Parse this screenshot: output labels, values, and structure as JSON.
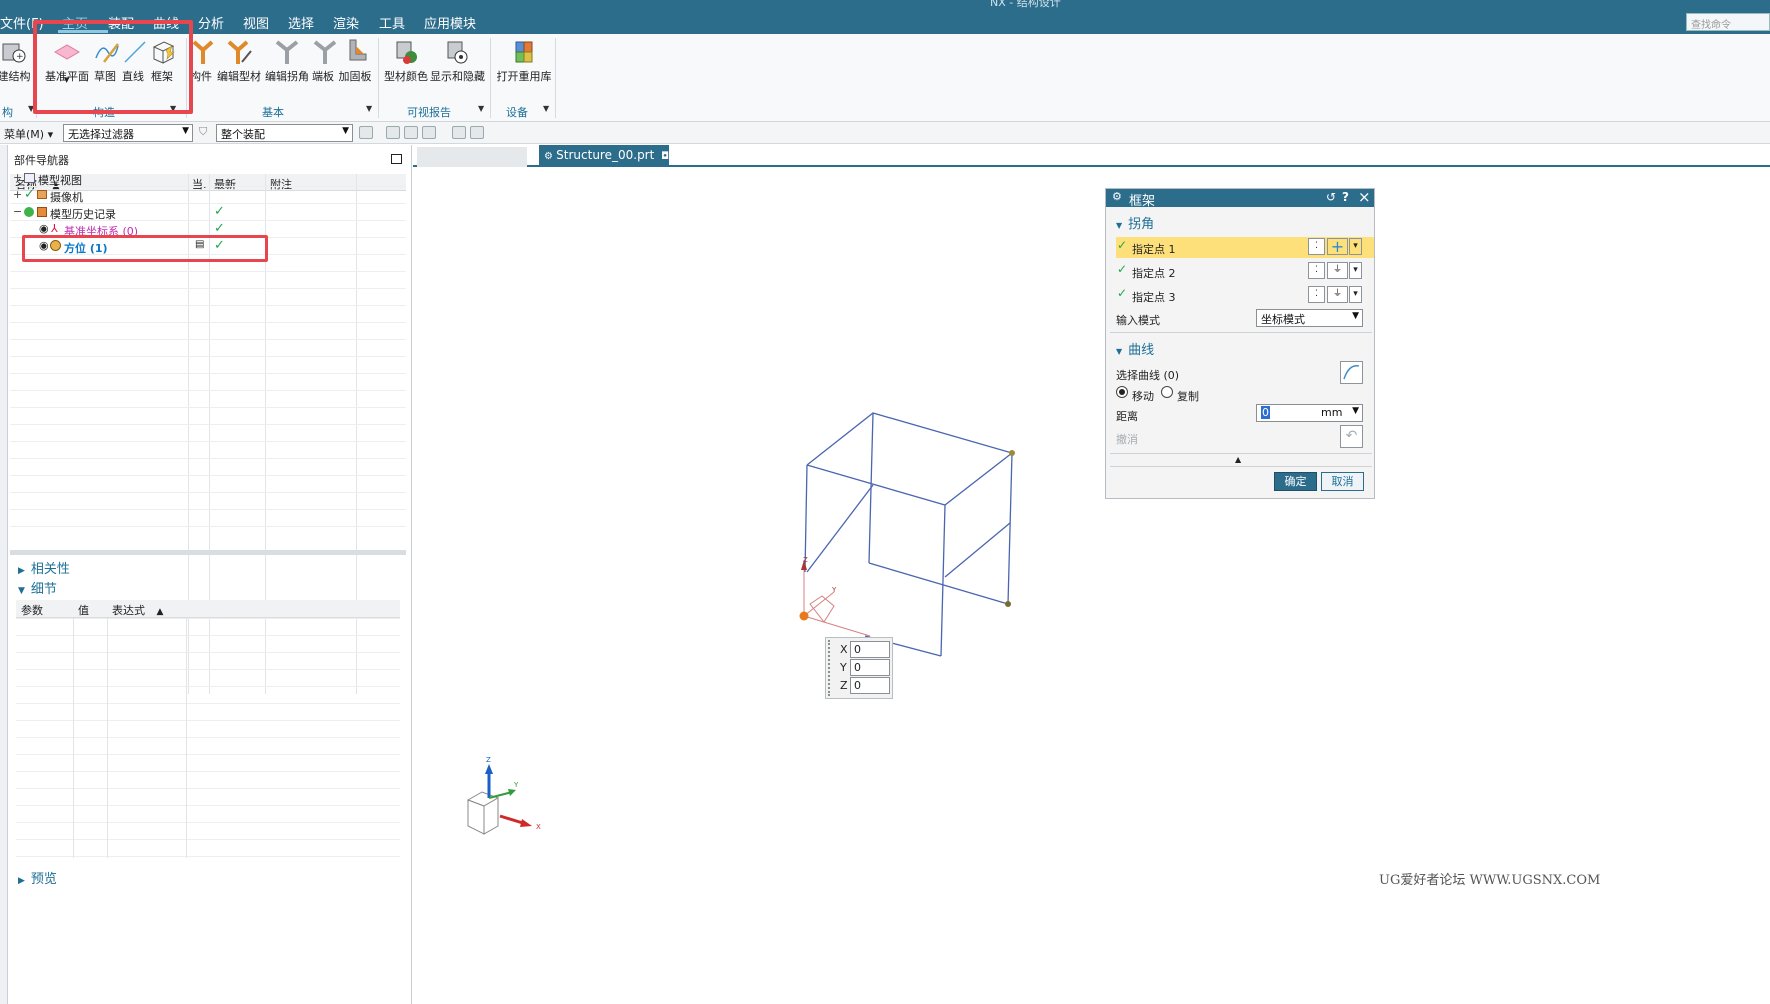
{
  "menu": {
    "items": [
      "文件(F)",
      "主页",
      "装配",
      "曲线",
      "分析",
      "视图",
      "选择",
      "渲染",
      "工具",
      "应用模块"
    ],
    "active": "主页",
    "window_title": "NX - 结构设计",
    "search_placeholder": "查找命令"
  },
  "ribbon": {
    "left_partial": "建结构",
    "construct": {
      "buttons": [
        "基准平面",
        "草图",
        "直线",
        "框架"
      ],
      "group_label": "构造"
    },
    "basic": {
      "buttons": [
        "构件",
        "编辑型材",
        "编辑拐角",
        "端板",
        "加固板"
      ],
      "group_label": "基本"
    },
    "visual": {
      "buttons": [
        "型材颜色",
        "显示和隐藏"
      ],
      "group_label": "可视报告"
    },
    "equipment": {
      "buttons": [
        "打开重用库"
      ],
      "group_label": "设备"
    },
    "left_group_label": "构"
  },
  "toolbar2": {
    "menu_label": "菜单(M)",
    "filter_value": "无选择过滤器",
    "scope_value": "整个装配"
  },
  "navigator": {
    "title": "部件导航器",
    "columns": [
      "名称",
      "当.",
      "最新",
      "附注"
    ],
    "rows": [
      {
        "label": "模型视图",
        "expander": "+",
        "latest": false
      },
      {
        "label": "摄像机",
        "expander": "+",
        "latest": false
      },
      {
        "label": "模型历史记录",
        "expander": "−",
        "latest": true
      },
      {
        "label": "基准坐标系 (0)",
        "expander": "",
        "latest": true
      },
      {
        "label": "方位 (1)",
        "expander": "",
        "latest": true
      }
    ],
    "sections": {
      "dependencies": "相关性",
      "details": "细节",
      "preview": "预览"
    },
    "detail_columns": [
      "参数",
      "值",
      "表达式"
    ]
  },
  "viewport": {
    "file_tab": "Structure_00.prt",
    "coord_entry": {
      "x_label": "X",
      "x_value": "0",
      "y_label": "Y",
      "y_value": "0",
      "z_label": "Z",
      "z_value": "0"
    }
  },
  "dialog": {
    "title": "框架",
    "corner_section": "拐角",
    "point1": "指定点 1",
    "point2": "指定点 2",
    "point3": "指定点 3",
    "input_mode_label": "输入模式",
    "input_mode_value": "坐标模式",
    "curve_section": "曲线",
    "select_curve": "选择曲线 (0)",
    "move_label": "移动",
    "copy_label": "复制",
    "distance_label": "距离",
    "distance_value": "0",
    "distance_unit": "mm",
    "undo_label": "撤消",
    "ok_label": "确定",
    "cancel_label": "取消"
  },
  "watermark": "UG爱好者论坛 WWW.UGSNX.COM",
  "colors": {
    "title_bar": "#2d6d8c",
    "accent_blue": "#1d6f97",
    "highlight_red": "#e8464f",
    "highlight_yellow": "#fde07a",
    "check_green": "#1fa84a",
    "wireframe": "#4a66b0"
  }
}
